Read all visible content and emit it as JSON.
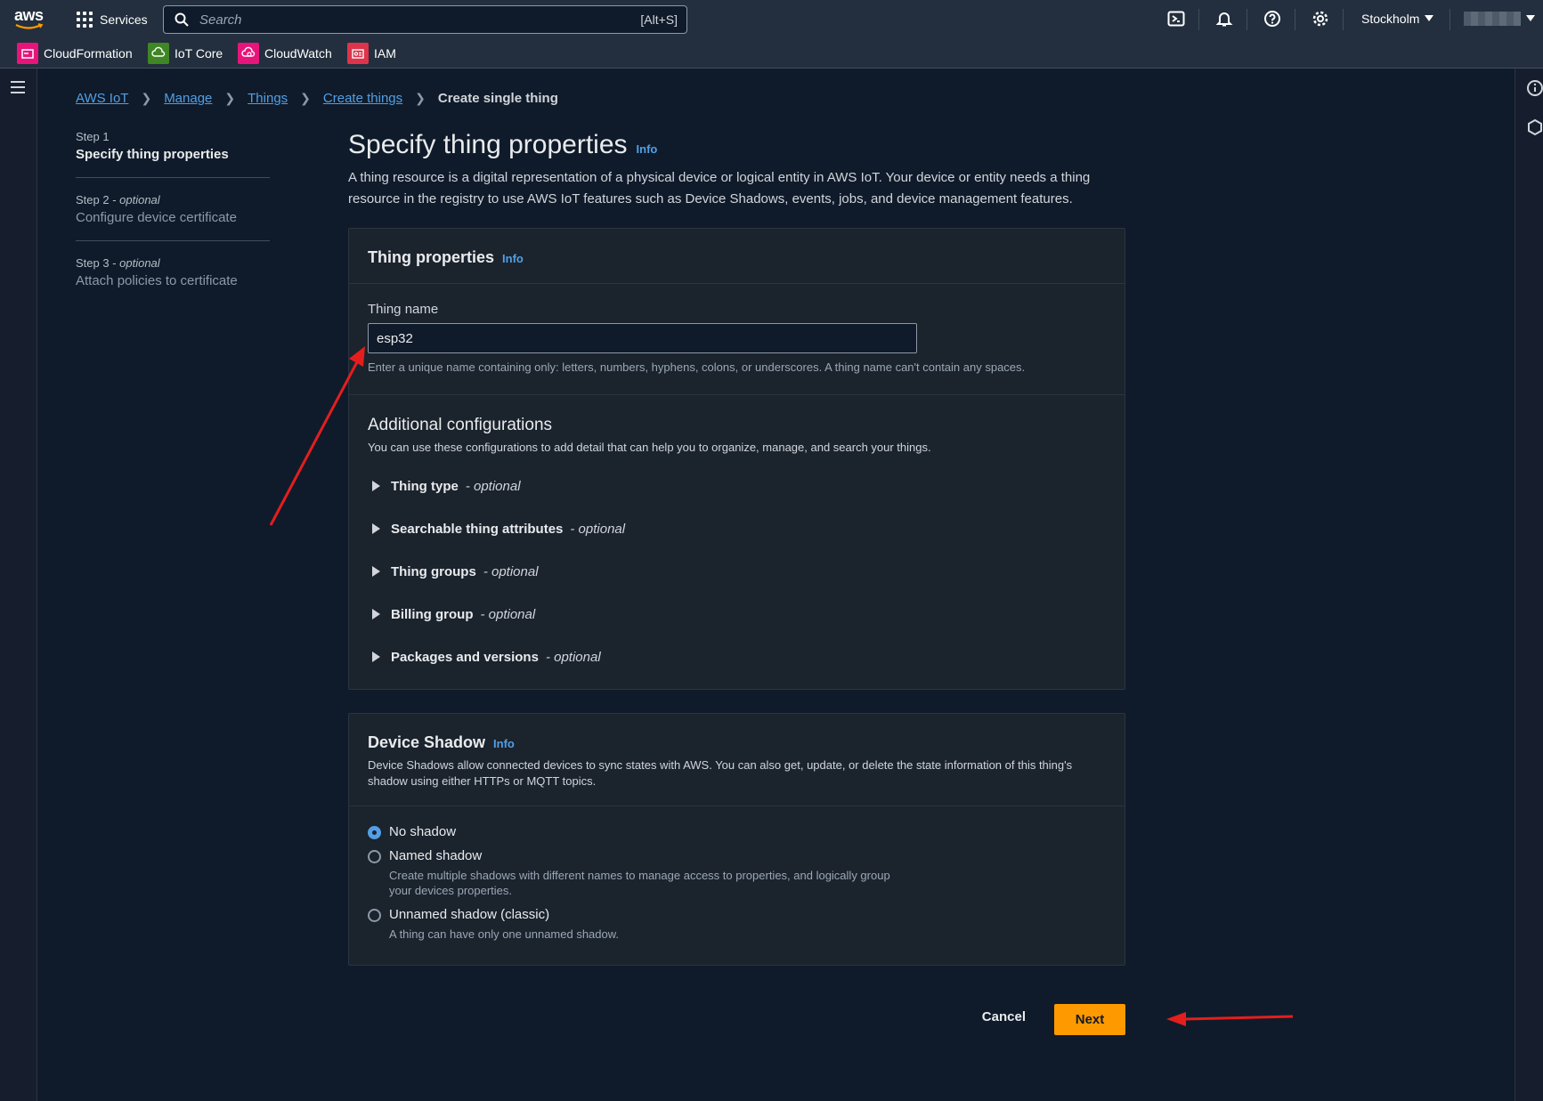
{
  "topbar": {
    "logo_text": "aws",
    "services_label": "Services",
    "search_placeholder": "Search",
    "search_shortcut": "[Alt+S]",
    "region": "Stockholm"
  },
  "favorites": [
    {
      "label": "CloudFormation",
      "color": "#e7157b"
    },
    {
      "label": "IoT Core",
      "color": "#3f8624"
    },
    {
      "label": "CloudWatch",
      "color": "#e7157b"
    },
    {
      "label": "IAM",
      "color": "#dd344c"
    }
  ],
  "breadcrumb": {
    "items": [
      "AWS IoT",
      "Manage",
      "Things",
      "Create things"
    ],
    "current": "Create single thing"
  },
  "steps": [
    {
      "num": "Step 1",
      "optional": "",
      "title": "Specify thing properties"
    },
    {
      "num": "Step 2 - ",
      "optional": "optional",
      "title": "Configure device certificate"
    },
    {
      "num": "Step 3 - ",
      "optional": "optional",
      "title": "Attach policies to certificate"
    }
  ],
  "page": {
    "title": "Specify thing properties",
    "info": "Info",
    "description": "A thing resource is a digital representation of a physical device or logical entity in AWS IoT. Your device or entity needs a thing resource in the registry to use AWS IoT features such as Device Shadows, events, jobs, and device management features."
  },
  "thing_properties": {
    "heading": "Thing properties",
    "info": "Info",
    "name_label": "Thing name",
    "name_value": "esp32",
    "name_hint": "Enter a unique name containing only: letters, numbers, hyphens, colons, or underscores. A thing name can't contain any spaces.",
    "additional_heading": "Additional configurations",
    "additional_desc": "You can use these configurations to add detail that can help you to organize, manage, and search your things.",
    "optional_suffix": " - ",
    "optional_word": "optional",
    "expanders": [
      "Thing type",
      "Searchable thing attributes",
      "Thing groups",
      "Billing group",
      "Packages and versions"
    ]
  },
  "device_shadow": {
    "heading": "Device Shadow",
    "info": "Info",
    "description": "Device Shadows allow connected devices to sync states with AWS. You can also get, update, or delete the state information of this thing's shadow using either HTTPs or MQTT topics.",
    "options": [
      {
        "label": "No shadow",
        "desc": "",
        "selected": true
      },
      {
        "label": "Named shadow",
        "desc": "Create multiple shadows with different names to manage access to properties, and logically group your devices properties.",
        "selected": false
      },
      {
        "label": "Unnamed shadow (classic)",
        "desc": "A thing can have only one unnamed shadow.",
        "selected": false
      }
    ]
  },
  "actions": {
    "cancel": "Cancel",
    "next": "Next"
  },
  "annotation_color": "#e41e1e"
}
